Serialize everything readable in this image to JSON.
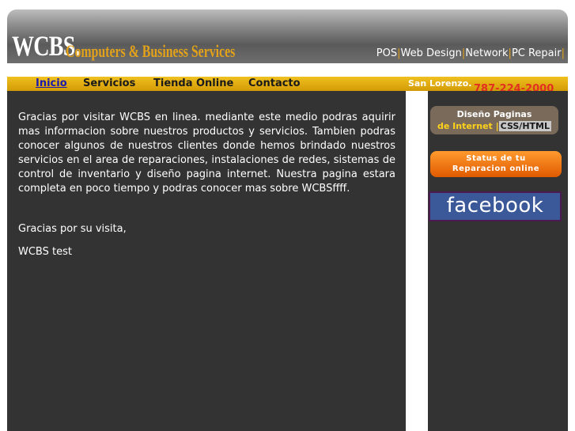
{
  "header": {
    "logo_main": "WCBS.",
    "logo_sub": "Computers & Business Services",
    "services": [
      "POS",
      "Web Design",
      "Network",
      "PC Repair"
    ]
  },
  "nav": {
    "items": [
      "Inicio",
      "Servicios",
      "Tienda Online",
      "Contacto"
    ],
    "location": "San Lorenzo.",
    "phone": "787-224-2000"
  },
  "main": {
    "intro": "Gracias por visitar WCBS en linea. mediante este medio podras aquirir mas informacion sobre nuestros productos y servicios. Tambien podras conocer algunos de nuestros clientes donde hemos brindado nuestros servicios en el area de reparaciones, instalaciones de redes, sistemas de control de inventario y diseño pagina internet. Nuestra pagina estara completa en poco tiempo y podras conocer mas sobre WCBSffff.",
    "thanks": "Gracias por su visita,",
    "signature": "WCBS test"
  },
  "sidebar": {
    "diseno_line1": "Diseño Paginas",
    "diseno_line2": "de Internet",
    "diseno_sep": "|",
    "diseno_css": "CSS/HTML",
    "status_line1": "Status de tu",
    "status_line2": "Reparacion online",
    "facebook": "facebook"
  },
  "colors": {
    "accent": "#e3a21a",
    "nav_bg": "#e0ac10",
    "content_bg": "#333333",
    "facebook_bg": "#3b5998"
  }
}
